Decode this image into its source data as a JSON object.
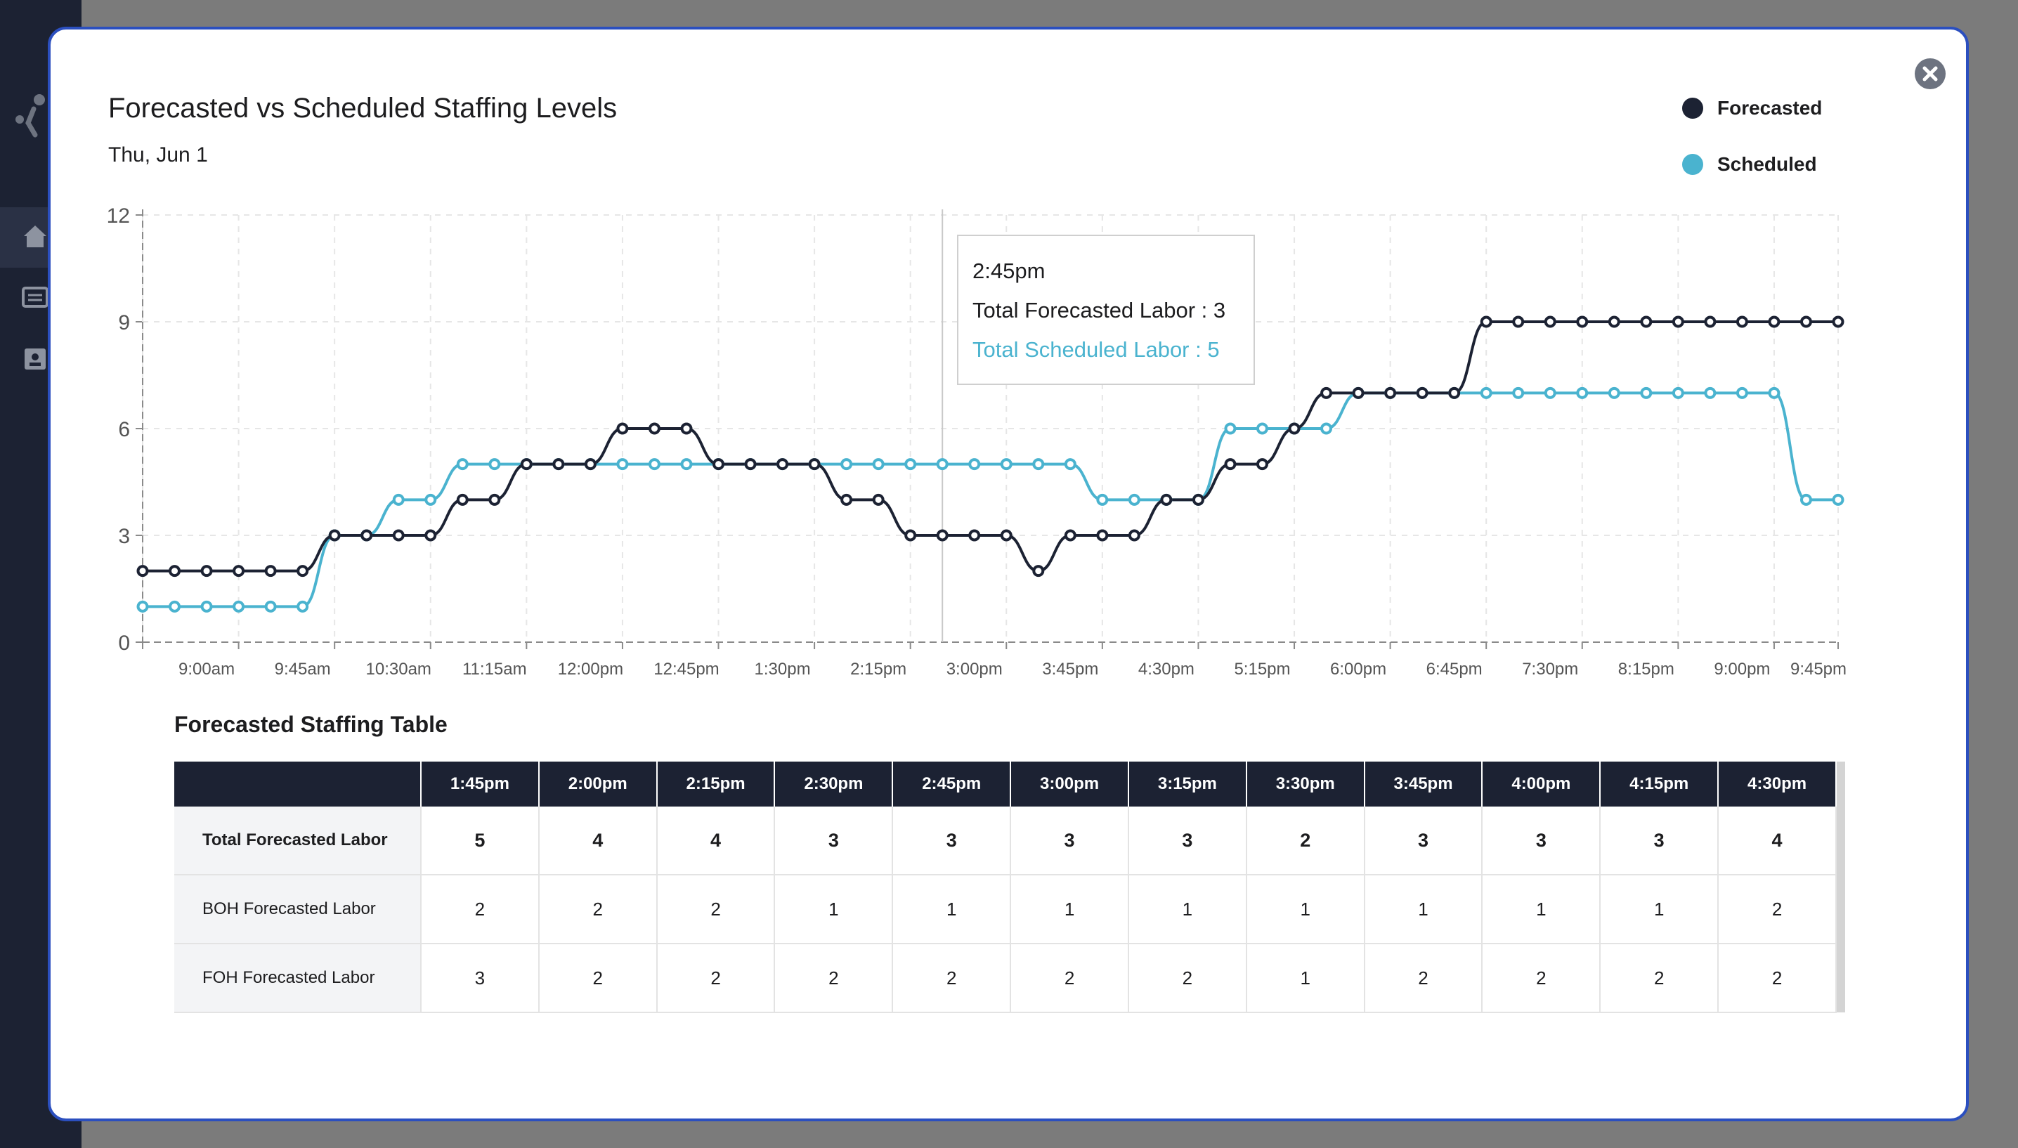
{
  "modal": {
    "title": "Forecasted vs Scheduled Staffing Levels",
    "date": "Thu, Jun 1",
    "close_label": "close"
  },
  "legend": [
    {
      "label": "Forecasted",
      "color": "#1c2233"
    },
    {
      "label": "Scheduled",
      "color": "#4ab3cf"
    }
  ],
  "tooltip": {
    "time": "2:45pm",
    "forecasted": "Total Forecasted Labor : 3",
    "scheduled": "Total Scheduled Labor : 5"
  },
  "chart_data": {
    "type": "line",
    "x": [
      "8:30am",
      "8:45am",
      "9:00am",
      "9:15am",
      "9:30am",
      "9:45am",
      "10:00am",
      "10:15am",
      "10:30am",
      "10:45am",
      "11:00am",
      "11:15am",
      "11:30am",
      "11:45am",
      "12:00pm",
      "12:15pm",
      "12:30pm",
      "12:45pm",
      "1:00pm",
      "1:15pm",
      "1:30pm",
      "1:45pm",
      "2:00pm",
      "2:15pm",
      "2:30pm",
      "2:45pm",
      "3:00pm",
      "3:15pm",
      "3:30pm",
      "3:45pm",
      "4:00pm",
      "4:15pm",
      "4:30pm",
      "4:45pm",
      "5:00pm",
      "5:15pm",
      "5:30pm",
      "5:45pm",
      "6:00pm",
      "6:15pm",
      "6:30pm",
      "6:45pm",
      "7:00pm",
      "7:15pm",
      "7:30pm",
      "7:45pm",
      "8:00pm",
      "8:15pm",
      "8:30pm",
      "8:45pm",
      "9:00pm",
      "9:15pm",
      "9:30pm",
      "9:45pm"
    ],
    "x_tick_labels": [
      "9:00am",
      "9:45am",
      "10:30am",
      "11:15am",
      "12:00pm",
      "12:45pm",
      "1:30pm",
      "2:15pm",
      "3:00pm",
      "3:45pm",
      "4:30pm",
      "5:15pm",
      "6:00pm",
      "6:45pm",
      "7:30pm",
      "8:15pm",
      "9:00pm",
      "9:45pm"
    ],
    "y_ticks": [
      "0",
      "3",
      "6",
      "9",
      "12"
    ],
    "ylim": [
      0,
      12
    ],
    "grid": true,
    "legend_position": "top-right",
    "series": [
      {
        "name": "Forecasted",
        "color": "#1c2233",
        "values": [
          2,
          2,
          2,
          2,
          2,
          2,
          3,
          3,
          3,
          3,
          4,
          4,
          5,
          5,
          5,
          6,
          6,
          6,
          5,
          5,
          5,
          5,
          4,
          4,
          3,
          3,
          3,
          3,
          2,
          3,
          3,
          3,
          4,
          4,
          5,
          5,
          6,
          7,
          7,
          7,
          7,
          7,
          9,
          9,
          9,
          9,
          9,
          9,
          9,
          9,
          9,
          9,
          9,
          9
        ]
      },
      {
        "name": "Scheduled",
        "color": "#4ab3cf",
        "values": [
          1,
          1,
          1,
          1,
          1,
          1,
          3,
          3,
          4,
          4,
          5,
          5,
          5,
          5,
          5,
          5,
          5,
          5,
          5,
          5,
          5,
          5,
          5,
          5,
          5,
          5,
          5,
          5,
          5,
          5,
          4,
          4,
          4,
          4,
          6,
          6,
          6,
          6,
          7,
          7,
          7,
          7,
          7,
          7,
          7,
          7,
          7,
          7,
          7,
          7,
          7,
          7,
          4,
          4
        ]
      }
    ]
  },
  "table": {
    "title": "Forecasted Staffing Table",
    "headers": [
      "1:45pm",
      "2:00pm",
      "2:15pm",
      "2:30pm",
      "2:45pm",
      "3:00pm",
      "3:15pm",
      "3:30pm",
      "3:45pm",
      "4:00pm",
      "4:15pm",
      "4:30pm"
    ],
    "rows": [
      {
        "label": "Total Forecasted Labor",
        "bold": true,
        "values": [
          "5",
          "4",
          "4",
          "3",
          "3",
          "3",
          "3",
          "2",
          "3",
          "3",
          "3",
          "4"
        ]
      },
      {
        "label": "BOH Forecasted Labor",
        "bold": false,
        "values": [
          "2",
          "2",
          "2",
          "1",
          "1",
          "1",
          "1",
          "1",
          "1",
          "1",
          "1",
          "2"
        ]
      },
      {
        "label": "FOH Forecasted Labor",
        "bold": false,
        "values": [
          "3",
          "2",
          "2",
          "2",
          "2",
          "2",
          "2",
          "1",
          "2",
          "2",
          "2",
          "2"
        ]
      }
    ]
  },
  "colors": {
    "forecasted": "#1c2233",
    "scheduled": "#4ab3cf",
    "modal_border": "#2b4fbf"
  },
  "sidebar_icons": [
    "logo-icon",
    "home-icon",
    "schedule-icon",
    "badge-icon"
  ]
}
